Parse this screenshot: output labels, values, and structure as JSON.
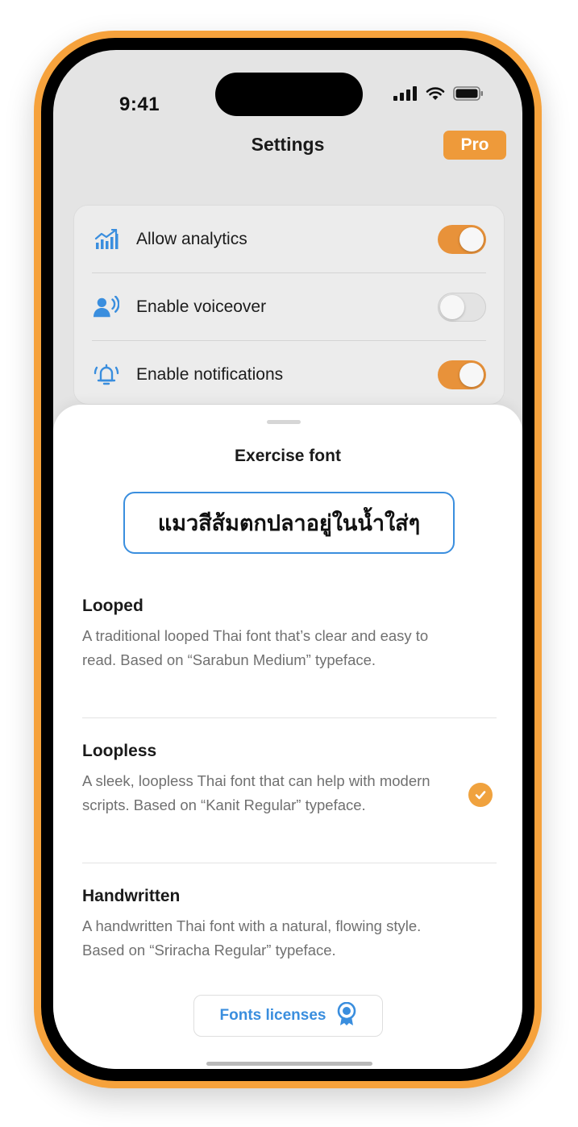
{
  "status_bar": {
    "time": "9:41"
  },
  "header": {
    "title": "Settings",
    "pro_badge": "Pro"
  },
  "settings": [
    {
      "label": "Allow analytics",
      "icon": "analytics-icon",
      "enabled": true
    },
    {
      "label": "Enable voiceover",
      "icon": "voiceover-icon",
      "enabled": false
    },
    {
      "label": "Enable notifications",
      "icon": "bell-icon",
      "enabled": true
    }
  ],
  "sheet": {
    "title": "Exercise font",
    "preview_text": "แมวสีส้มตกปลาอยู่ในน้ำใส่ๆ",
    "options": [
      {
        "name": "Looped",
        "description": "A traditional looped Thai font that’s clear and easy to read. Based on “Sarabun Medium” typeface.",
        "selected": false
      },
      {
        "name": "Loopless",
        "description": "A sleek, loopless Thai font that can help with modern scripts. Based on “Kanit Regular” typeface.",
        "selected": true
      },
      {
        "name": "Handwritten",
        "description": "A handwritten Thai font with a natural, flowing style. Based on “Sriracha Regular” typeface.",
        "selected": false
      }
    ],
    "licenses_button": "Fonts licenses"
  },
  "colors": {
    "accent_orange": "#ee9a3a",
    "accent_blue": "#3a8ede",
    "frame": "#f6a23c"
  }
}
